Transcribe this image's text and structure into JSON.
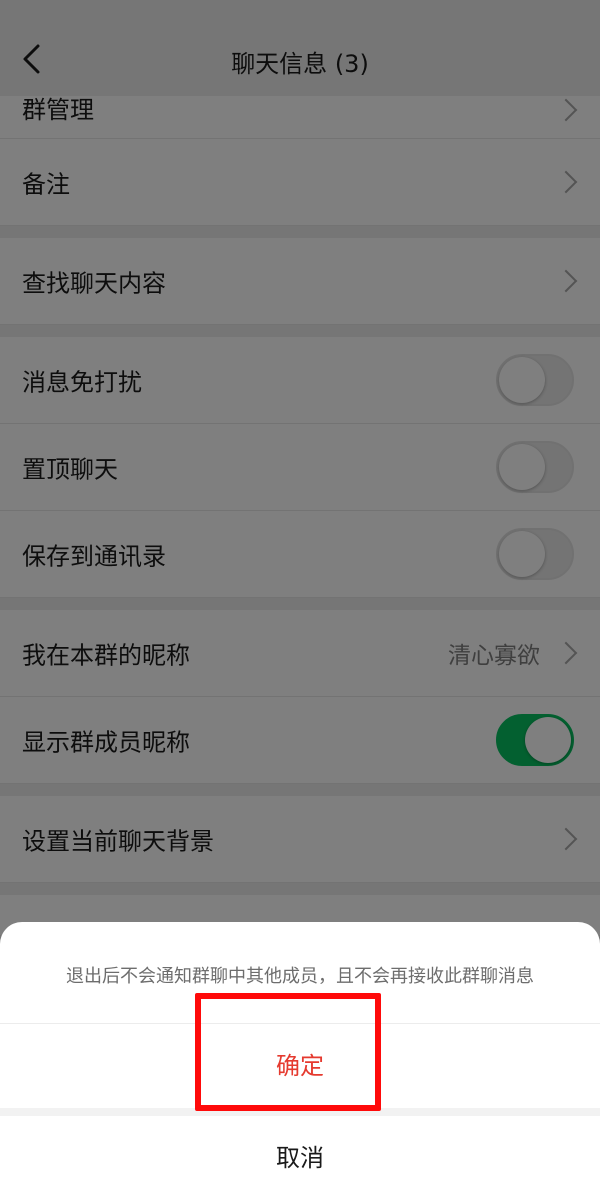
{
  "nav": {
    "title": "聊天信息 (3)"
  },
  "sections": {
    "group_notice": {
      "label": "群管理"
    },
    "remark": {
      "label": "备注"
    },
    "search_chat": {
      "label": "查找聊天内容"
    },
    "mute": {
      "label": "消息免打扰",
      "on": false
    },
    "pin": {
      "label": "置顶聊天",
      "on": false
    },
    "save_contacts": {
      "label": "保存到通讯录",
      "on": false
    },
    "my_nickname": {
      "label": "我在本群的昵称",
      "value": "清心寡欲"
    },
    "show_nicknames": {
      "label": "显示群成员昵称",
      "on": true
    },
    "background": {
      "label": "设置当前聊天背景"
    }
  },
  "dialog": {
    "message": "退出后不会通知群聊中其他成员，且不会再接收此群聊消息",
    "confirm_label": "确定",
    "cancel_label": "取消"
  },
  "colors": {
    "accent_green": "#07c160",
    "destructive_red": "#e53a2f",
    "highlight_red": "#ff0a0a"
  }
}
